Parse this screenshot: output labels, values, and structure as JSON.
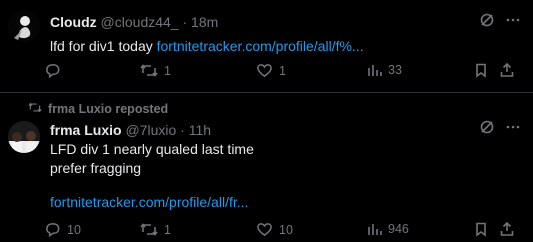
{
  "tweets": [
    {
      "name": "Cloudz",
      "handle": "@cloudz44_",
      "separator": "·",
      "time": "18m",
      "text": "lfd for div1 today",
      "link": "fortnitetracker.com/profile/all/f%...",
      "replies": "",
      "reposts": "1",
      "likes": "1",
      "views": "33"
    },
    {
      "repost_label": "frma Luxio reposted",
      "name": "frma Luxio",
      "handle": "@7luxio",
      "separator": "·",
      "time": "11h",
      "line1": "LFD div 1 nearly qualed last time",
      "line2": "prefer fragging",
      "link": "fortnitetracker.com/profile/all/fr...",
      "replies": "10",
      "reposts": "1",
      "likes": "10",
      "views": "946"
    }
  ],
  "colors": {
    "background": "#000000",
    "text": "#e7e9ea",
    "muted": "#71767b",
    "link": "#1d9bf0"
  }
}
